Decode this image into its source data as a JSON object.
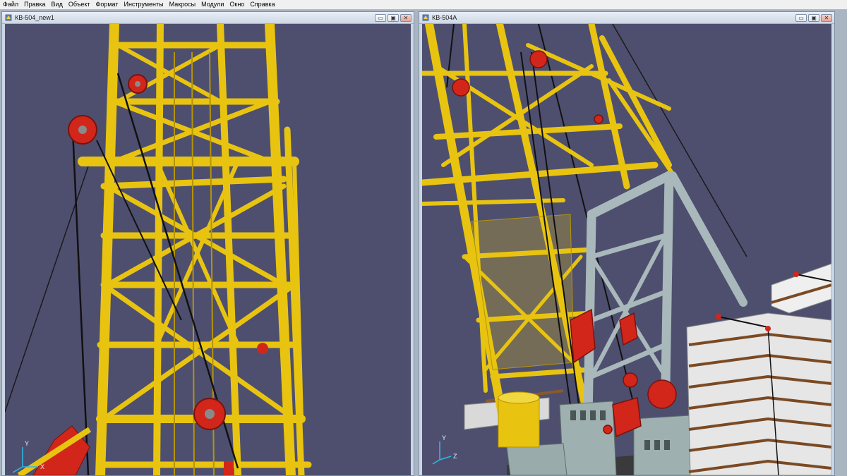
{
  "menu": {
    "items": [
      "Файл",
      "Правка",
      "Вид",
      "Объект",
      "Формат",
      "Инструменты",
      "Макросы",
      "Модули",
      "Окно",
      "Справка"
    ]
  },
  "windows": {
    "left": {
      "title": "КВ-504_new1",
      "controls": {
        "minimize": "▭",
        "restore": "▣",
        "close": "✕"
      }
    },
    "right": {
      "title": "КВ-504А",
      "controls": {
        "minimize": "▭",
        "restore": "▣",
        "close": "✕"
      }
    }
  },
  "triad": {
    "x": "X",
    "y": "Y",
    "z": "Z"
  },
  "colors": {
    "viewport_bg": "#4e4f6f",
    "truss_yellow": "#e8c411",
    "truss_dark": "#b59408",
    "pulley_red": "#d2261b",
    "steel_gray": "#aab8bb",
    "building_white": "#e8e8e8",
    "building_band": "#7a4a24"
  }
}
